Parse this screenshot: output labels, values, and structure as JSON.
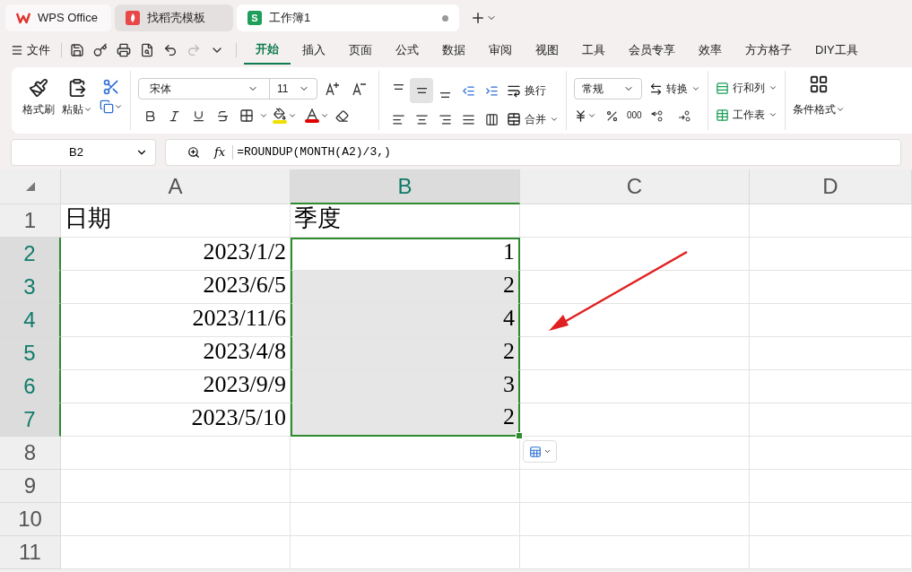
{
  "browser_tabs": [
    {
      "kind": "home",
      "label": "WPS Office",
      "selected": false
    },
    {
      "kind": "template",
      "label": "找稻壳模板",
      "selected": false
    },
    {
      "kind": "sheet",
      "badge": "S",
      "label": "工作簿1",
      "selected": true,
      "unsaved": true
    }
  ],
  "menu": {
    "file": "文件",
    "redo_disabled": true,
    "tabs": [
      {
        "label": "开始",
        "selected": true
      },
      {
        "label": "插入",
        "selected": false
      },
      {
        "label": "页面",
        "selected": false
      },
      {
        "label": "公式",
        "selected": false
      },
      {
        "label": "数据",
        "selected": false
      },
      {
        "label": "审阅",
        "selected": false
      },
      {
        "label": "视图",
        "selected": false
      },
      {
        "label": "工具",
        "selected": false
      },
      {
        "label": "会员专享",
        "selected": false
      },
      {
        "label": "效率",
        "selected": false
      },
      {
        "label": "方方格子",
        "selected": false
      },
      {
        "label": "DIY工具",
        "selected": false
      }
    ]
  },
  "ribbon": {
    "format_painter": "格式刷",
    "paste": "粘贴",
    "font_name": "宋体",
    "font_size": "11",
    "vertical_align": [
      {
        "selected": false
      },
      {
        "selected": true
      },
      {
        "selected": false
      }
    ],
    "wrap": "换行",
    "merge": "合并",
    "number_format": "常规",
    "convert": "转换",
    "thousands": "000",
    "rows_cols": "行和列",
    "sheet": "工作表",
    "conditional_format": "条件格式"
  },
  "formula_bar": {
    "cell_ref": "B2",
    "fx": "fx",
    "formula": "=ROUNDUP(MONTH(A2)/3,)"
  },
  "grid": {
    "columns": [
      {
        "label": "A",
        "selected": false
      },
      {
        "label": "B",
        "selected": true
      },
      {
        "label": "C",
        "selected": false
      },
      {
        "label": "D",
        "selected": false
      }
    ],
    "rows": [
      {
        "header": "1",
        "selected": false,
        "cells": [
          {
            "kind": "text",
            "text": "日期",
            "selected": false,
            "active": false
          },
          {
            "kind": "text",
            "text": "季度",
            "selected": false,
            "active": false
          }
        ]
      },
      {
        "header": "2",
        "selected": true,
        "cells": [
          {
            "kind": "number",
            "text": "2023/1/2",
            "selected": false,
            "active": false
          },
          {
            "kind": "number",
            "text": "1",
            "selected": true,
            "active": true
          }
        ]
      },
      {
        "header": "3",
        "selected": true,
        "cells": [
          {
            "kind": "number",
            "text": "2023/6/5",
            "selected": false,
            "active": false
          },
          {
            "kind": "number",
            "text": "2",
            "selected": true,
            "active": false
          }
        ]
      },
      {
        "header": "4",
        "selected": true,
        "cells": [
          {
            "kind": "number",
            "text": "2023/11/6",
            "selected": false,
            "active": false
          },
          {
            "kind": "number",
            "text": "4",
            "selected": true,
            "active": false
          }
        ]
      },
      {
        "header": "5",
        "selected": true,
        "cells": [
          {
            "kind": "number",
            "text": "2023/4/8",
            "selected": false,
            "active": false
          },
          {
            "kind": "number",
            "text": "2",
            "selected": true,
            "active": false
          }
        ]
      },
      {
        "header": "6",
        "selected": true,
        "cells": [
          {
            "kind": "number",
            "text": "2023/9/9",
            "selected": false,
            "active": false
          },
          {
            "kind": "number",
            "text": "3",
            "selected": true,
            "active": false
          }
        ]
      },
      {
        "header": "7",
        "selected": true,
        "cells": [
          {
            "kind": "number",
            "text": "2023/5/10",
            "selected": false,
            "active": false
          },
          {
            "kind": "number",
            "text": "2",
            "selected": true,
            "active": false
          }
        ]
      },
      {
        "header": "8",
        "selected": false
      },
      {
        "header": "9",
        "selected": false
      },
      {
        "header": "10",
        "selected": false
      },
      {
        "header": "11",
        "selected": false
      }
    ]
  }
}
